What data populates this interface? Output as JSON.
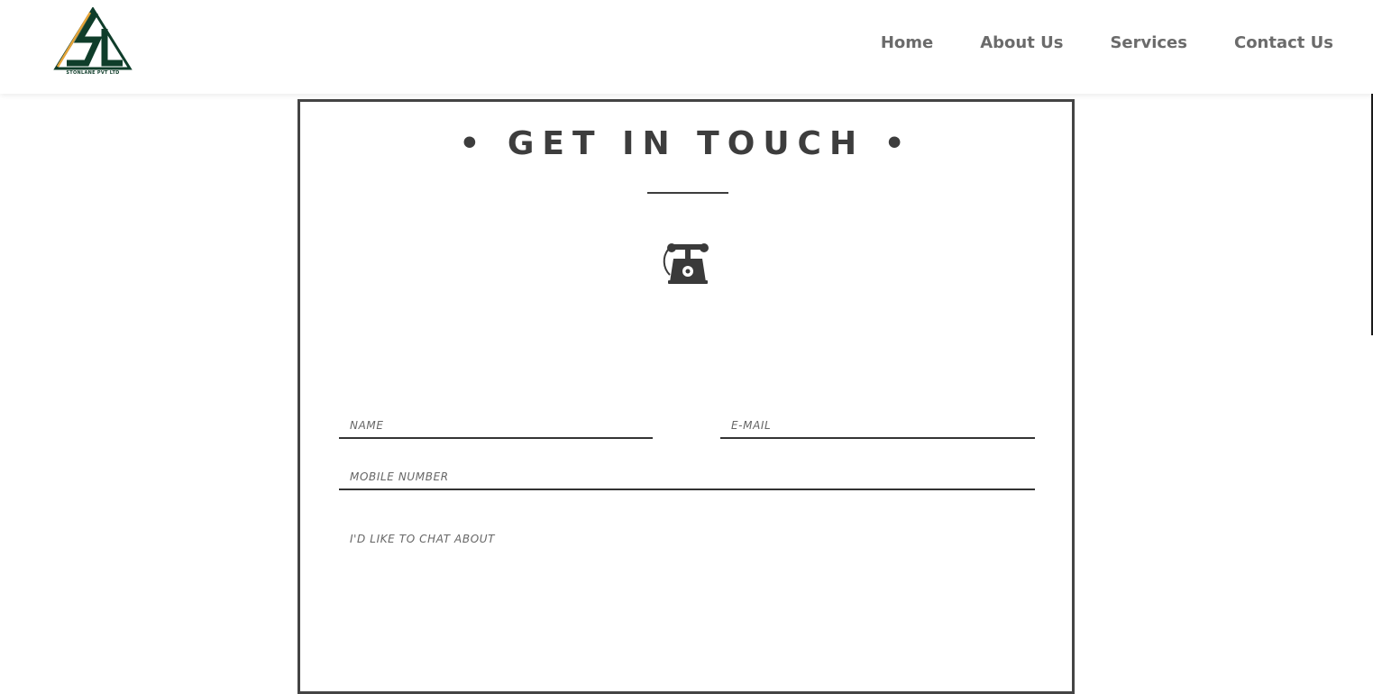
{
  "brand": {
    "name": "STONLANE PVT LTD",
    "logo_colors": {
      "dark": "#0f3d2a",
      "accent": "#e7a53a"
    }
  },
  "nav": {
    "items": [
      {
        "label": "Home"
      },
      {
        "label": "About Us"
      },
      {
        "label": "Services"
      },
      {
        "label": "Contact Us"
      }
    ]
  },
  "contact": {
    "title": "• GET IN TOUCH •",
    "icon": "telephone-icon",
    "fields": {
      "name_placeholder": "NAME",
      "email_placeholder": "E-MAIL",
      "mobile_placeholder": "MOBILE NUMBER",
      "chat_placeholder": "I'D LIKE TO CHAT ABOUT"
    }
  }
}
